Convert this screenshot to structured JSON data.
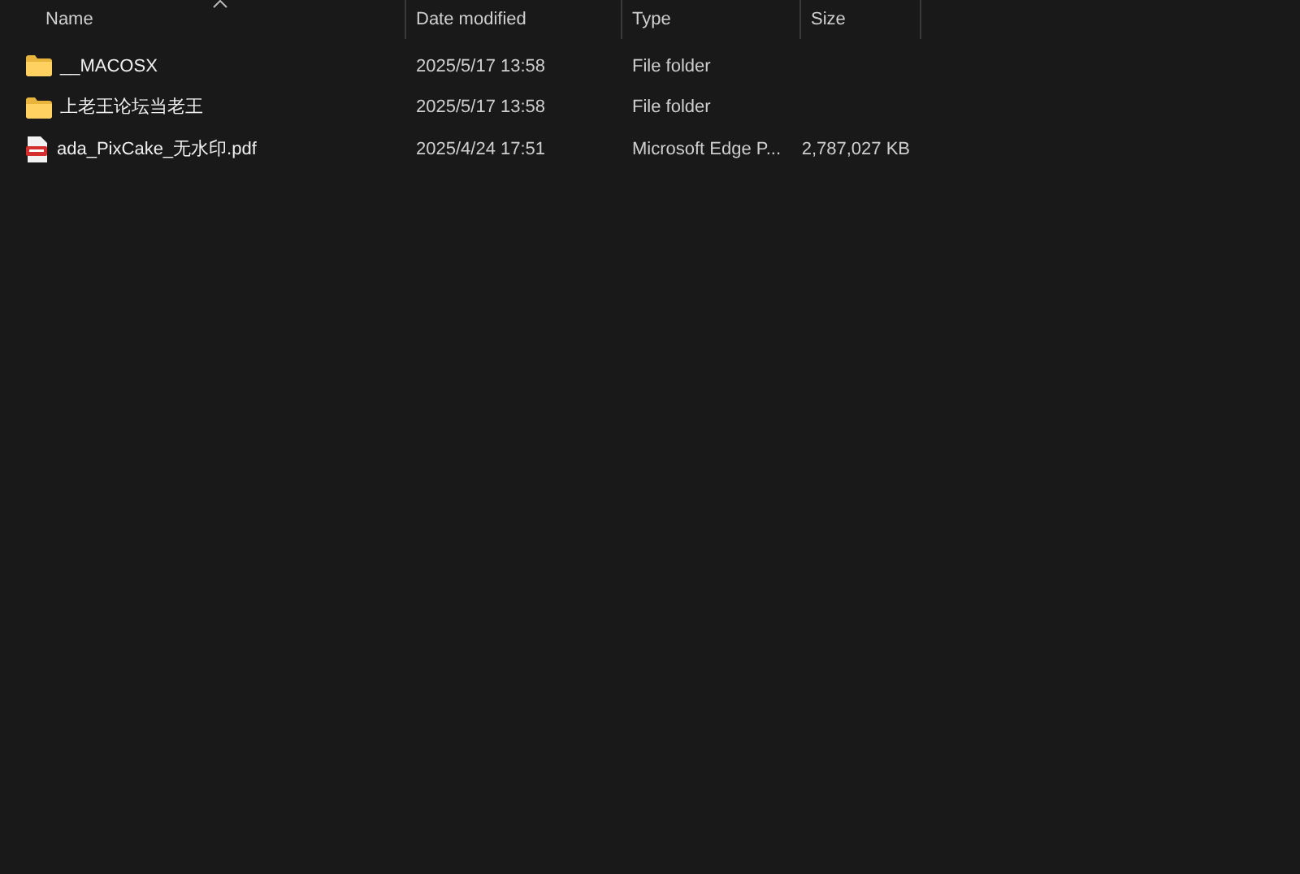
{
  "columns": [
    {
      "label": "Name",
      "sorted": true
    },
    {
      "label": "Date modified",
      "sorted": false
    },
    {
      "label": "Type",
      "sorted": false
    },
    {
      "label": "Size",
      "sorted": false
    }
  ],
  "rows": [
    {
      "kind": "folder",
      "name": "__MACOSX",
      "date": "2025/5/17 13:58",
      "type": "File folder"
    },
    {
      "kind": "folder",
      "name": "上老王论坛当老王",
      "date": "2025/5/17 13:58",
      "type": "File folder"
    },
    {
      "kind": "pdf",
      "name": "ada_PixCake_无水印.pdf",
      "date": "2025/4/24 17:51",
      "type": "Microsoft Edge P...",
      "size": "2,787,027 KB"
    }
  ]
}
